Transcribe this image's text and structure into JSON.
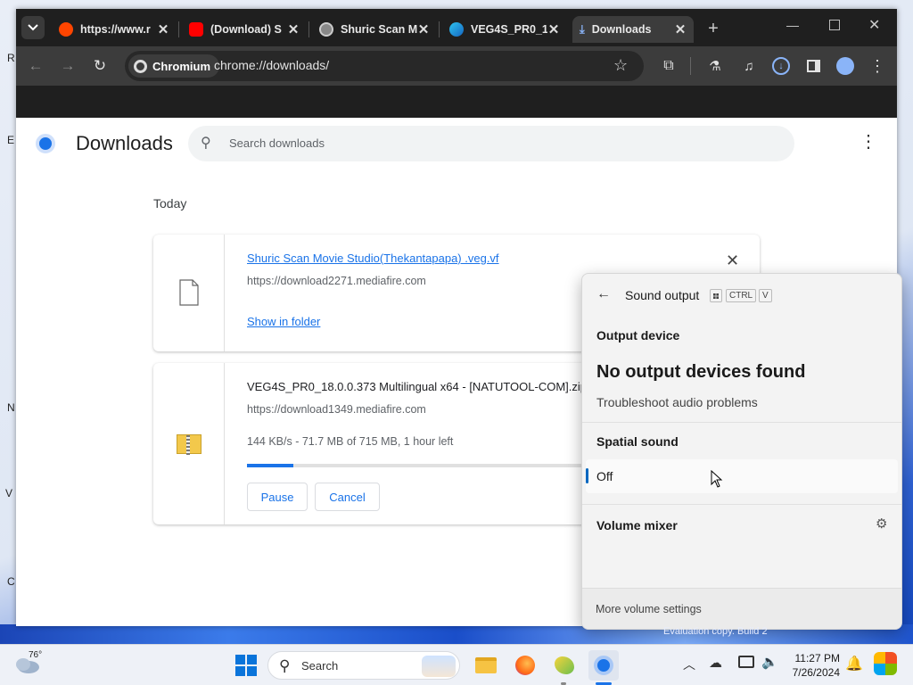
{
  "browser": {
    "tabs": [
      {
        "title": "https://www.r",
        "icon": "reddit-icon"
      },
      {
        "title": "(Download) S",
        "icon": "youtube-icon"
      },
      {
        "title": "Shuric Scan M",
        "icon": "globe-icon"
      },
      {
        "title": "VEG4S_PR0_1",
        "icon": "vegas-icon"
      },
      {
        "title": "Downloads",
        "icon": "download-icon"
      }
    ],
    "omnibox": {
      "chip": "Chromium",
      "url": "chrome://downloads/"
    }
  },
  "downloads_page": {
    "title": "Downloads",
    "search_placeholder": "Search downloads",
    "date_group": "Today",
    "items": [
      {
        "filename": "Shuric Scan Movie Studio(Thekantapapa) .veg.vf",
        "source": "https://download2271.mediafire.com",
        "action": "Show in folder"
      },
      {
        "filename": "VEG4S_PR0_18.0.0.373 Multilingual x64 - [NATUTOOL-COM].zip",
        "source": "https://download1349.mediafire.com",
        "status": "144 KB/s - 71.7 MB of 715 MB, 1 hour left",
        "progress": 0.1,
        "pause_label": "Pause",
        "cancel_label": "Cancel"
      }
    ]
  },
  "sound_panel": {
    "title": "Sound output",
    "shortcut": [
      "CTRL",
      "V"
    ],
    "output_device_heading": "Output device",
    "no_devices": "No output devices found",
    "troubleshoot": "Troubleshoot audio problems",
    "spatial_heading": "Spatial sound",
    "spatial_value": "Off",
    "mixer_heading": "Volume mixer",
    "more_settings": "More volume settings"
  },
  "watermark": "Evaluation copy. Build 2",
  "taskbar": {
    "weather_temp": "76°",
    "search_label": "Search",
    "time": "11:27 PM",
    "date": "7/26/2024"
  },
  "colors": {
    "accent": "#1a73e8",
    "tab_dark": "#1f1f1f",
    "toolbar": "#3c3c3c"
  }
}
